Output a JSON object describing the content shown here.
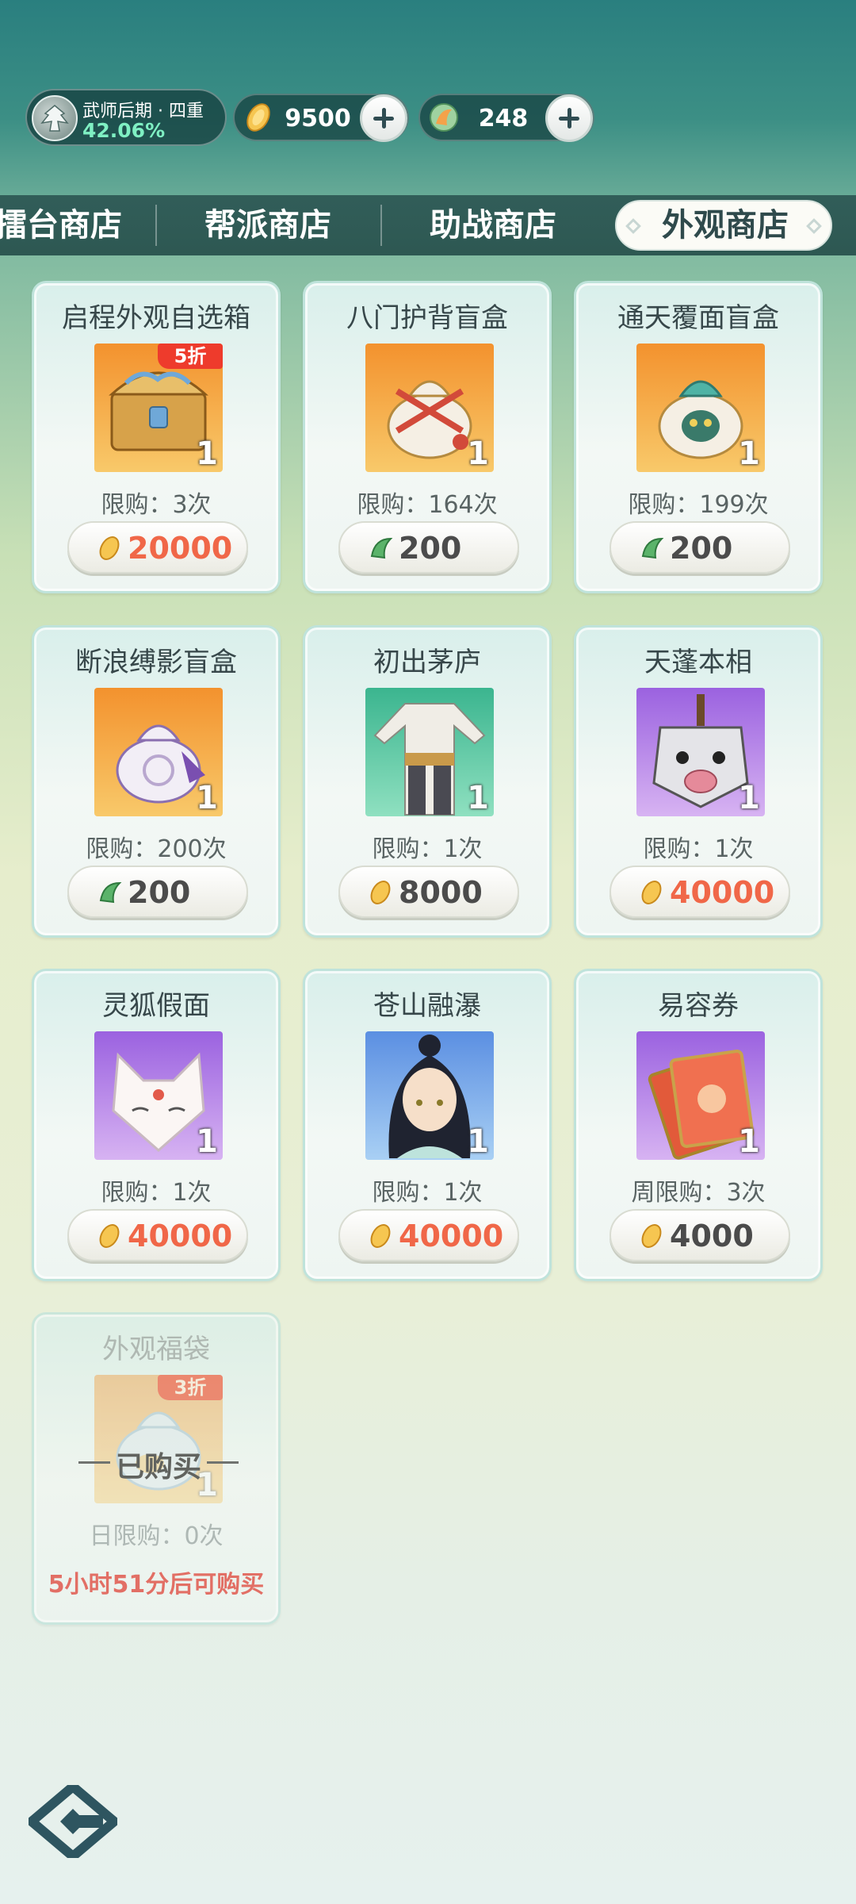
{
  "header": {
    "rank_title": "武师后期 · 四重",
    "rank_progress": "42.06%",
    "currencies": [
      {
        "icon": "gold-ingot-icon",
        "value": "9500"
      },
      {
        "icon": "jade-token-icon",
        "value": "248"
      }
    ]
  },
  "tabs": [
    {
      "label": "擂台商店",
      "active": false
    },
    {
      "label": "帮派商店",
      "active": false
    },
    {
      "label": "助战商店",
      "active": false
    },
    {
      "label": "外观商店",
      "active": true
    }
  ],
  "items": [
    {
      "name": "启程外观自选箱",
      "qty": "1",
      "badge": "5折",
      "limit": "限购：3次",
      "price": "20000",
      "currency": "gold-ingot-icon"
    },
    {
      "name": "八门护背盲盒",
      "qty": "1",
      "limit": "限购：164次",
      "price": "200",
      "currency": "jade-token-icon"
    },
    {
      "name": "通天覆面盲盒",
      "qty": "1",
      "limit": "限购：199次",
      "price": "200",
      "currency": "jade-token-icon"
    },
    {
      "name": "断浪缚影盲盒",
      "qty": "1",
      "limit": "限购：200次",
      "price": "200",
      "currency": "jade-token-icon"
    },
    {
      "name": "初出茅庐",
      "qty": "1",
      "limit": "限购：1次",
      "price": "8000",
      "currency": "gold-ingot-icon"
    },
    {
      "name": "天蓬本相",
      "qty": "1",
      "limit": "限购：1次",
      "price": "40000",
      "currency": "gold-ingot-icon"
    },
    {
      "name": "灵狐假面",
      "qty": "1",
      "limit": "限购：1次",
      "price": "40000",
      "currency": "gold-ingot-icon"
    },
    {
      "name": "苍山融瀑",
      "qty": "1",
      "limit": "限购：1次",
      "price": "40000",
      "currency": "gold-ingot-icon"
    },
    {
      "name": "易容券",
      "qty": "1",
      "limit": "周限购：3次",
      "price": "4000",
      "currency": "gold-ingot-icon"
    },
    {
      "name": "外观福袋",
      "qty": "1",
      "badge": "3折",
      "status": "已购买",
      "limit": "日限购：0次",
      "countdown": "5小时51分后可购买"
    }
  ]
}
